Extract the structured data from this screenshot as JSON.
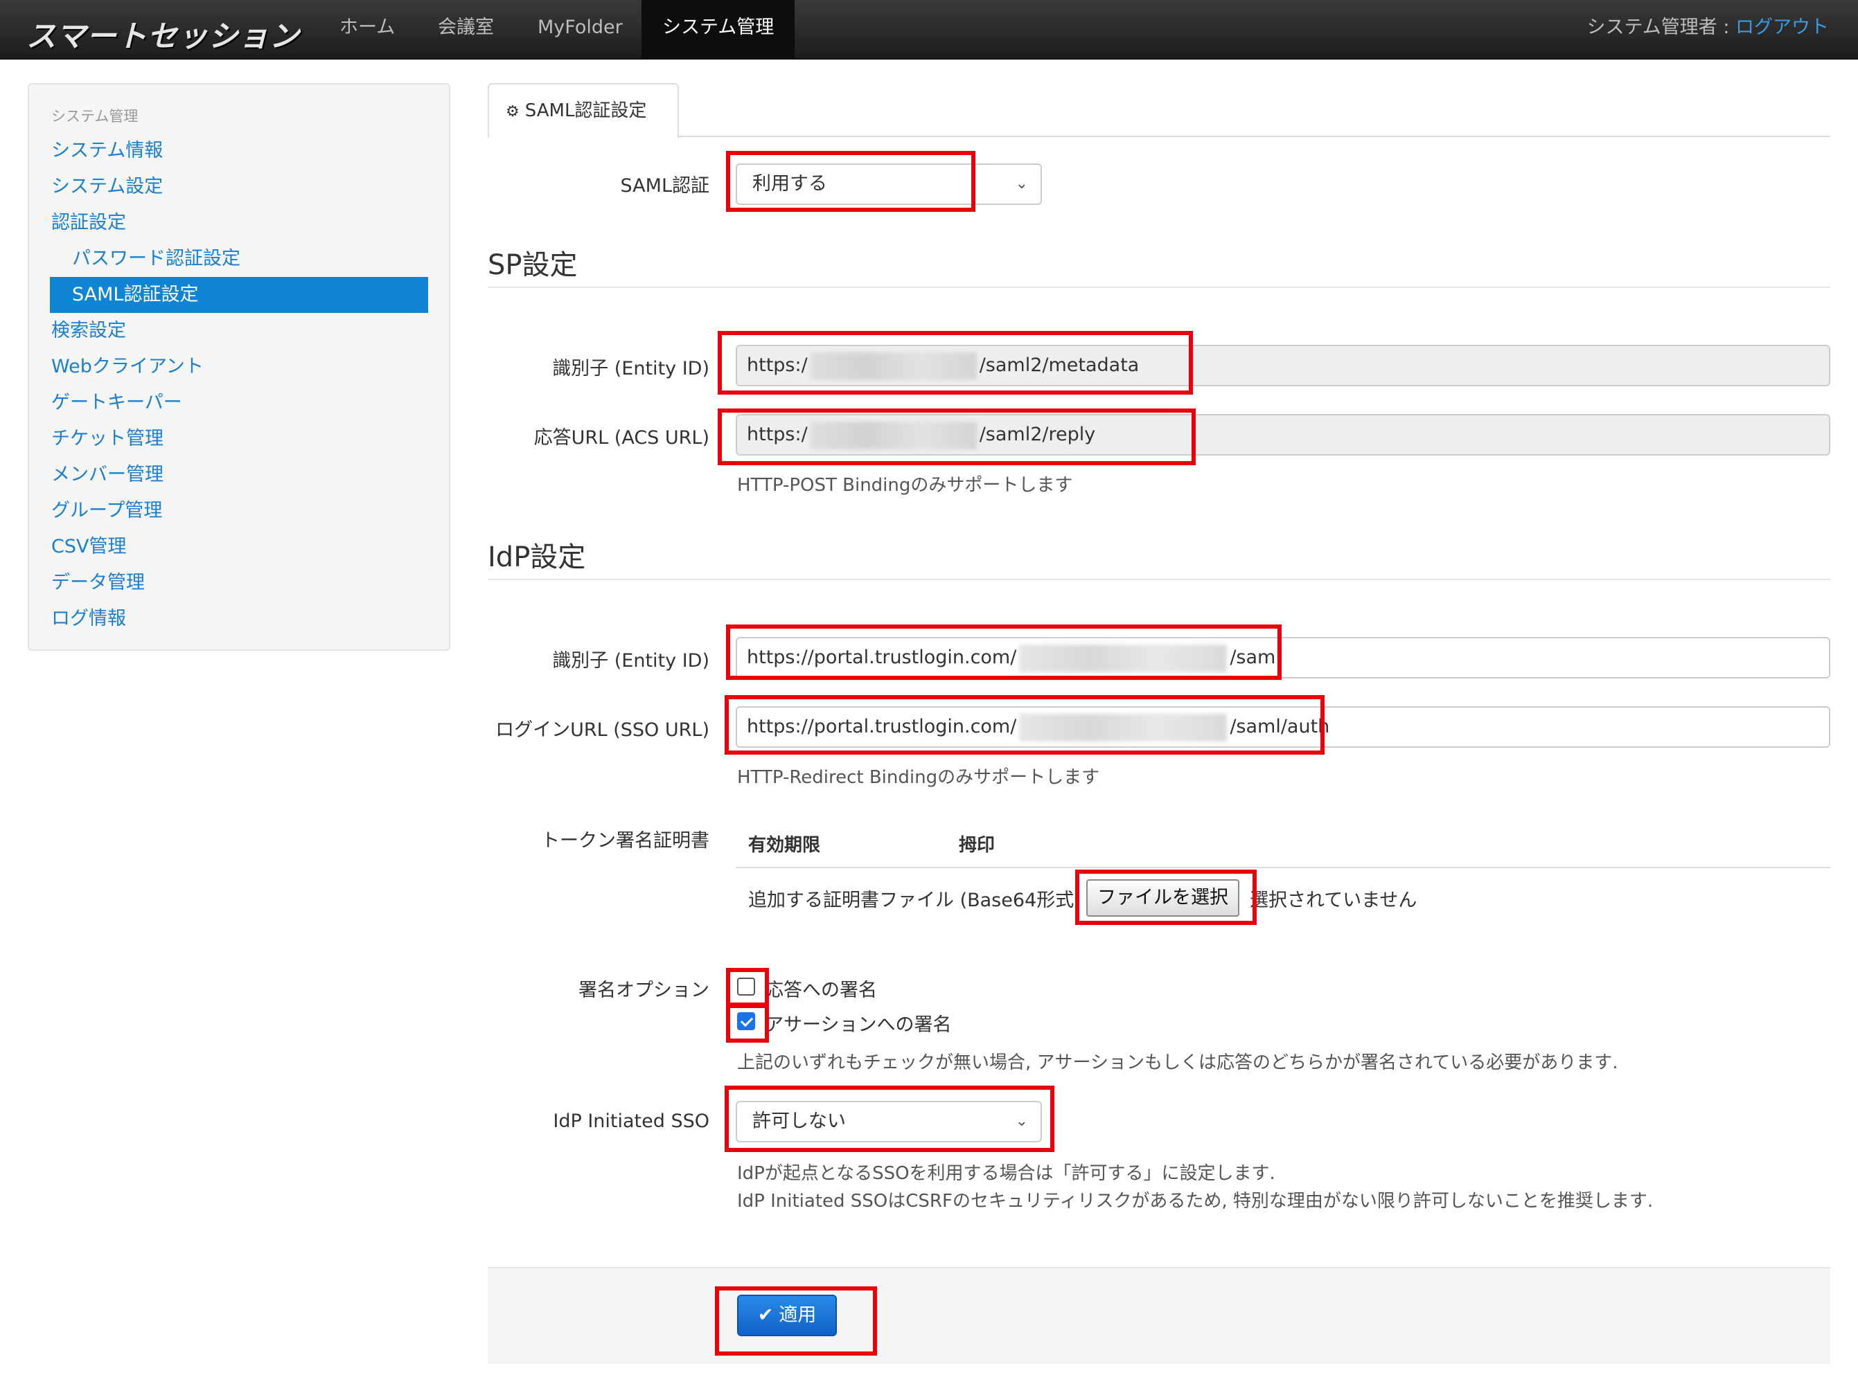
{
  "navbar": {
    "brand": "スマートセッション",
    "items": [
      {
        "label": "ホーム"
      },
      {
        "label": "会議室"
      },
      {
        "label": "MyFolder"
      },
      {
        "label": "システム管理"
      }
    ],
    "user_label": "システム管理者 : ",
    "logout_label": "ログアウト"
  },
  "sidebar": {
    "header": "システム管理",
    "items": [
      {
        "label": "システム情報"
      },
      {
        "label": "システム設定"
      },
      {
        "label": "認証設定"
      },
      {
        "label": "パスワード認証設定"
      },
      {
        "label": "SAML認証設定"
      },
      {
        "label": "検索設定"
      },
      {
        "label": "Webクライアント"
      },
      {
        "label": "ゲートキーパー"
      },
      {
        "label": "チケット管理"
      },
      {
        "label": "メンバー管理"
      },
      {
        "label": "グループ管理"
      },
      {
        "label": "CSV管理"
      },
      {
        "label": "データ管理"
      },
      {
        "label": "ログ情報"
      }
    ]
  },
  "tab": {
    "label": "SAML認証設定",
    "icon": "gear-icon"
  },
  "saml": {
    "label": "SAML認証",
    "value": "利用する"
  },
  "sp": {
    "title": "SP設定",
    "entity_label": "識別子 (Entity ID)",
    "entity_prefix": "https:/",
    "entity_suffix": "/saml2/metadata",
    "acs_label": "応答URL (ACS URL)",
    "acs_prefix": "https:/",
    "acs_suffix": "/saml2/reply",
    "acs_help": "HTTP-POST Bindingのみサポートします"
  },
  "idp": {
    "title": "IdP設定",
    "entity_label": "識別子 (Entity ID)",
    "entity_prefix": "https://portal.trustlogin.com/",
    "entity_suffix": "/saml",
    "sso_label": "ログインURL (SSO URL)",
    "sso_prefix": "https://portal.trustlogin.com/",
    "sso_suffix": "/saml/auth",
    "sso_help": "HTTP-Redirect Bindingのみサポートします",
    "cert_label": "トークン署名証明書",
    "cert_col_expiry": "有効期限",
    "cert_col_fingerprint": "拇印",
    "cert_file_label": "追加する証明書ファイル (Base64形式",
    "cert_file_button": "ファイルを選択",
    "cert_file_status": "選択されていません",
    "sign_label": "署名オプション",
    "sign_response": {
      "label": "応答への署名",
      "checked": false
    },
    "sign_assertion": {
      "label": "アサーションへの署名",
      "checked": true
    },
    "sign_help": "上記のいずれもチェックが無い場合, アサーションもしくは応答のどちらかが署名されている必要があります.",
    "initiated_label": "IdP Initiated SSO",
    "initiated_value": "許可しない",
    "initiated_help1": "IdPが起点となるSSOを利用する場合は「許可する」に設定します.",
    "initiated_help2": "IdP Initiated SSOはCSRFのセキュリティリスクがあるため, 特別な理由がない限り許可しないことを推奨します."
  },
  "apply_label": "適用",
  "colors": {
    "highlight": "#e8000a",
    "accent": "#0f84d2",
    "link": "#1a7fd1"
  }
}
